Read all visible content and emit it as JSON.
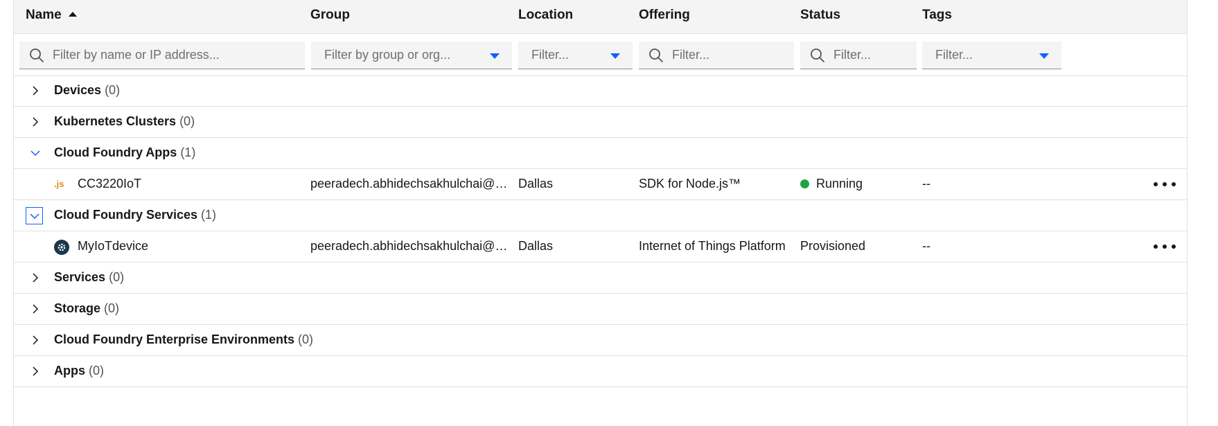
{
  "columns": {
    "name": "Name",
    "group": "Group",
    "location": "Location",
    "offering": "Offering",
    "status": "Status",
    "tags": "Tags"
  },
  "filters": {
    "name_placeholder": "Filter by name or IP address...",
    "group_placeholder": "Filter by group or org...",
    "location_placeholder": "Filter...",
    "offering_placeholder": "Filter...",
    "status_placeholder": "Filter...",
    "tags_placeholder": "Filter..."
  },
  "groups": [
    {
      "label": "Devices",
      "count": "(0)",
      "expanded": false
    },
    {
      "label": "Kubernetes Clusters",
      "count": "(0)",
      "expanded": false
    },
    {
      "label": "Cloud Foundry Apps",
      "count": "(1)",
      "expanded": true
    },
    {
      "label": "Cloud Foundry Services",
      "count": "(1)",
      "expanded": true
    },
    {
      "label": "Services",
      "count": "(0)",
      "expanded": false
    },
    {
      "label": "Storage",
      "count": "(0)",
      "expanded": false
    },
    {
      "label": "Cloud Foundry Enterprise Environments",
      "count": "(0)",
      "expanded": false
    },
    {
      "label": "Apps",
      "count": "(0)",
      "expanded": false
    }
  ],
  "resources": [
    {
      "icon": "nodejs-icon",
      "icon_text": ".js",
      "name": "CC3220IoT",
      "group": "peeradech.abhidechsakhulchai@sjsu.e...",
      "location": "Dallas",
      "offering": "SDK for Node.js™",
      "status": "Running",
      "status_color": "#24a148",
      "tags": "--"
    },
    {
      "icon": "iot-platform-icon",
      "name": "MyIoTdevice",
      "group": "peeradech.abhidechsakhulchai@sjsu.e...",
      "location": "Dallas",
      "offering": "Internet of Things Platform",
      "status": "Provisioned",
      "tags": "--"
    }
  ],
  "colors": {
    "accent": "#0f62fe",
    "header_bg": "#f4f4f4",
    "running": "#24a148",
    "nodejs": "#e8891c",
    "iot_icon_bg": "#1d3649"
  }
}
